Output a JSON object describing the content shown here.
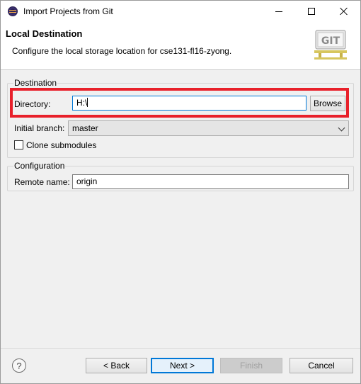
{
  "window": {
    "title": "Import Projects from Git"
  },
  "banner": {
    "title": "Local Destination",
    "description": "Configure the local storage location for cse131-fl16-zyong.",
    "logo_text": "GIT"
  },
  "destination": {
    "legend": "Destination",
    "directory_label": "Directory:",
    "directory_value": "H:\\",
    "browse_label": "Browse",
    "initial_branch_label": "Initial branch:",
    "initial_branch_value": "master",
    "clone_submodules_label": "Clone submodules",
    "clone_submodules_checked": false
  },
  "configuration": {
    "legend": "Configuration",
    "remote_name_label": "Remote name:",
    "remote_name_value": "origin"
  },
  "footer": {
    "help_glyph": "?",
    "back_label": "< Back",
    "next_label": "Next >",
    "finish_label": "Finish",
    "cancel_label": "Cancel"
  },
  "colors": {
    "highlight": "#e8202a",
    "focus": "#0078d7"
  }
}
